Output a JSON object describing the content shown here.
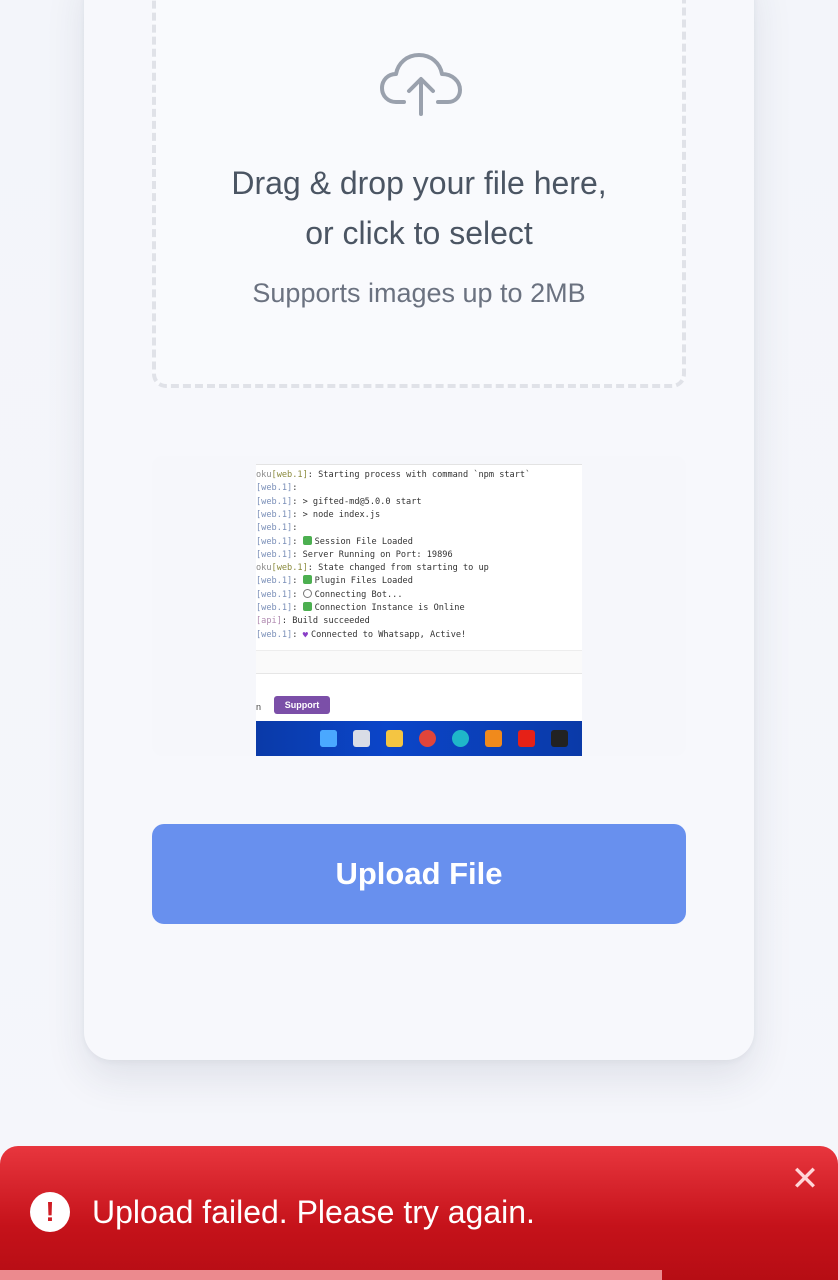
{
  "dropzone": {
    "icon": "cloud-upload-icon",
    "title_line1": "Drag & drop your file here,",
    "title_line2": "or click to select",
    "subtitle": "Supports images up to 2MB"
  },
  "preview": {
    "terminal_lines": [
      {
        "prefix": "oku",
        "proc": "[web.1]",
        "kind": "heroku",
        "icon": "",
        "text": ": Starting process with command `npm start`"
      },
      {
        "prefix": "",
        "proc": "[web.1]",
        "kind": "plain",
        "icon": "",
        "text": ":"
      },
      {
        "prefix": "",
        "proc": "[web.1]",
        "kind": "web",
        "icon": "",
        "text": ": > gifted-md@5.0.0 start"
      },
      {
        "prefix": "",
        "proc": "[web.1]",
        "kind": "web",
        "icon": "",
        "text": ": > node index.js"
      },
      {
        "prefix": "",
        "proc": "[web.1]",
        "kind": "plain",
        "icon": "",
        "text": ":"
      },
      {
        "prefix": "",
        "proc": "[web.1]",
        "kind": "web",
        "icon": "check",
        "text": ": Session File Loaded"
      },
      {
        "prefix": "",
        "proc": "[web.1]",
        "kind": "web",
        "icon": "",
        "text": ": Server Running on Port: 19896"
      },
      {
        "prefix": "oku",
        "proc": "[web.1]",
        "kind": "heroku",
        "icon": "",
        "text": ": State changed from starting to up"
      },
      {
        "prefix": "",
        "proc": "[web.1]",
        "kind": "web",
        "icon": "check",
        "text": ": Plugin Files Loaded"
      },
      {
        "prefix": "",
        "proc": "[web.1]",
        "kind": "web",
        "icon": "cycle",
        "text": ": Connecting Bot..."
      },
      {
        "prefix": "",
        "proc": "[web.1]",
        "kind": "web",
        "icon": "check",
        "text": ": Connection Instance is Online"
      },
      {
        "prefix": "",
        "proc": "[api]",
        "kind": "api",
        "icon": "",
        "text": ": Build succeeded"
      },
      {
        "prefix": "",
        "proc": "[web.1]",
        "kind": "web",
        "icon": "heart",
        "text": ": Connected to Whatsapp, Active!"
      }
    ],
    "edge_text": "n",
    "support_label": "Support",
    "taskbar_icons": [
      {
        "name": "windows-start-icon",
        "color": "#4aa8ff"
      },
      {
        "name": "task-view-icon",
        "color": "#d9dde6"
      },
      {
        "name": "file-explorer-icon",
        "color": "#f4c542"
      },
      {
        "name": "chrome-icon",
        "color": "#e0453a"
      },
      {
        "name": "edge-icon",
        "color": "#1fb6c9"
      },
      {
        "name": "vlc-icon",
        "color": "#f08a1c"
      },
      {
        "name": "youtube-icon",
        "color": "#e62117"
      },
      {
        "name": "app-icon",
        "color": "#222222"
      }
    ]
  },
  "upload_button": {
    "label": "Upload File"
  },
  "toast": {
    "icon": "alert-circle-icon",
    "icon_glyph": "!",
    "message": "Upload failed. Please try again.",
    "close_glyph": "✕",
    "progress_fraction": 0.79,
    "colors": {
      "background": "#c5121a",
      "progress": "#ec8a8e"
    }
  },
  "colors": {
    "accent": "#6890ee",
    "text_primary": "#4b5563",
    "text_secondary": "#6b7280"
  }
}
